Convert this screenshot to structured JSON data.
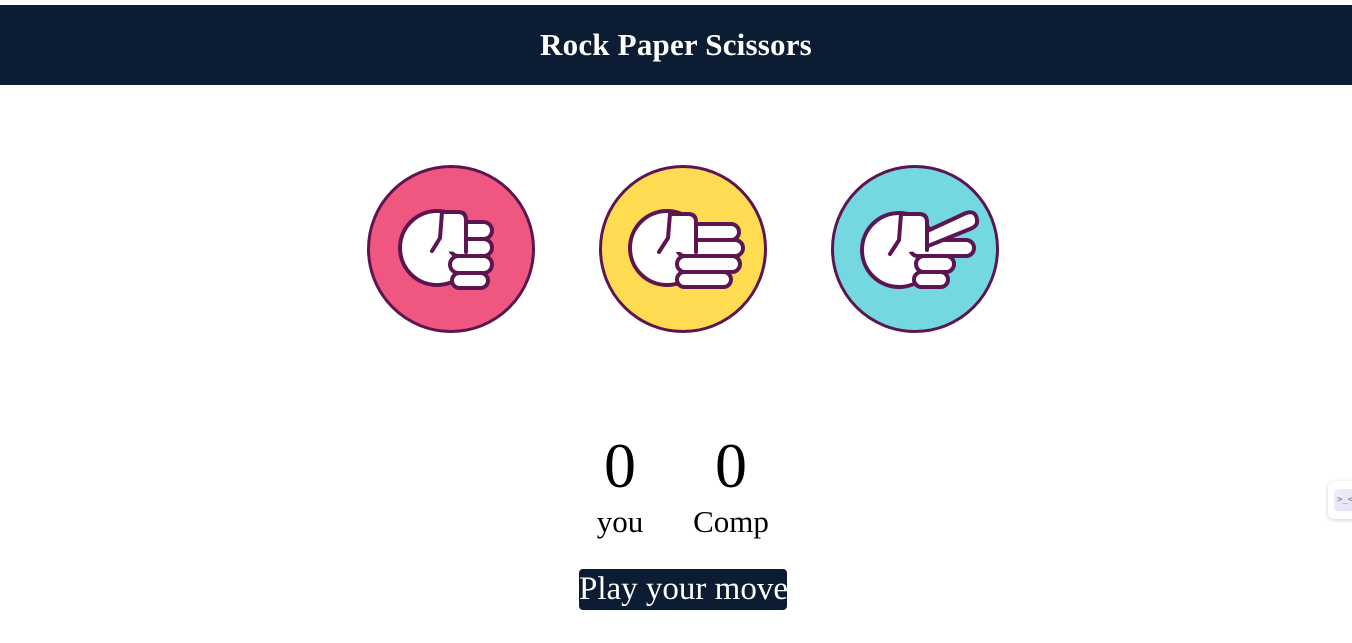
{
  "header": {
    "title": "Rock Paper Scissors"
  },
  "choices": [
    {
      "name": "rock",
      "icon": "rock-fist-icon",
      "color": "#ef5781"
    },
    {
      "name": "paper",
      "icon": "paper-hand-icon",
      "color": "#ffdc52"
    },
    {
      "name": "scissors",
      "icon": "scissors-hand-icon",
      "color": "#74d8e0"
    }
  ],
  "scoreboard": {
    "user_score": "0",
    "user_label": "you",
    "comp_score": "0",
    "comp_label": "Comp"
  },
  "message": {
    "text": "Play your move",
    "bg_color": "#0b1c33"
  },
  "colors": {
    "header_bg": "#0b1c33",
    "outline": "#5c1550"
  },
  "extension_widget": {
    "icon": ">_<"
  }
}
